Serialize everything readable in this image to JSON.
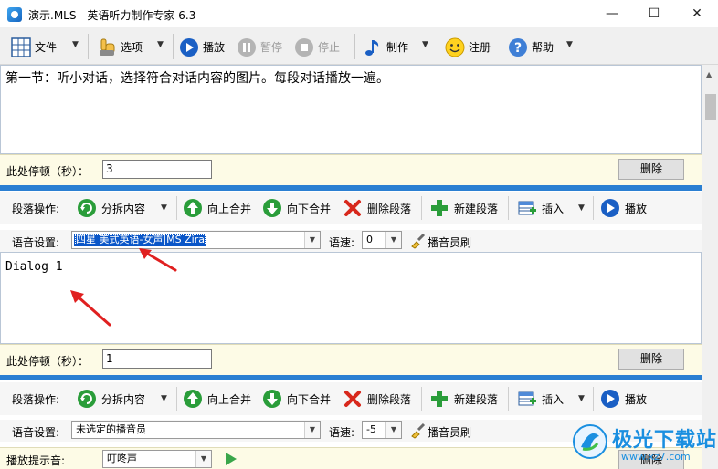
{
  "window": {
    "title": "演示.MLS - 英语听力制作专家 6.3",
    "minimize": "—",
    "maximize": "☐",
    "close": "✕"
  },
  "toolbar": {
    "file": "文件",
    "options": "选项",
    "play": "播放",
    "pause": "暂停",
    "stop": "停止",
    "make": "制作",
    "register": "注册",
    "help": "帮助"
  },
  "section": {
    "text": "第一节：听小对话，选择符合对话内容的图片。每段对话播放一遍。",
    "pause_label": "此处停顿（秒）：",
    "pause_value": "3",
    "delete": "删除"
  },
  "paragraphs": [
    {
      "toolbar_label": "段落操作:",
      "split": "分拆内容",
      "merge_up": "向上合并",
      "merge_down": "向下合并",
      "delete_para": "删除段落",
      "new_para": "新建段落",
      "insert": "插入",
      "play": "播放",
      "voice_label": "语音设置:",
      "voice_value": "四星 美式英语-女声|MS Zira",
      "speed_label": "语速:",
      "speed_value": "0",
      "announcer": "播音员刷",
      "text": "Dialog 1",
      "pause_label": "此处停顿（秒）：",
      "pause_value": "1",
      "delete": "删除"
    },
    {
      "toolbar_label": "段落操作:",
      "split": "分拆内容",
      "merge_up": "向上合并",
      "merge_down": "向下合并",
      "delete_para": "删除段落",
      "new_para": "新建段落",
      "insert": "插入",
      "play": "播放",
      "voice_label": "语音设置:",
      "voice_value": "未选定的播音员",
      "speed_label": "语速:",
      "speed_value": "-5",
      "announcer": "播音员刷"
    }
  ],
  "bottom": {
    "prompt_label": "播放提示音:",
    "prompt_value": "叮咚声",
    "delete": "删除"
  },
  "watermark": {
    "name": "极光下载站",
    "url": "www.xz7.com"
  },
  "colors": {
    "accent_blue": "#2b7fd2",
    "pause_row_bg": "#fdfbe6",
    "selection_blue": "#0a56c8",
    "arrow_red": "#e02020"
  }
}
